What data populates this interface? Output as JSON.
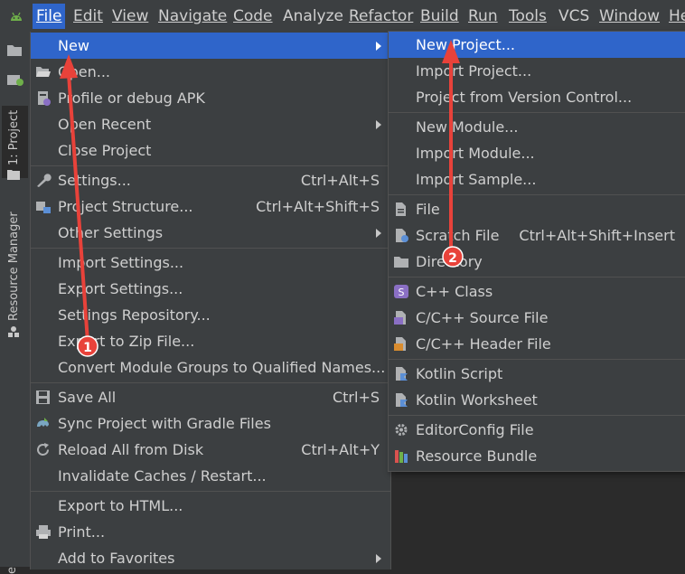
{
  "menubar": {
    "items": [
      "File",
      "Edit",
      "View",
      "Navigate",
      "Code",
      "Analyze",
      "Refactor",
      "Build",
      "Run",
      "Tools",
      "VCS",
      "Window",
      "He"
    ]
  },
  "tool_strip": {
    "project_tab": "1: Project",
    "resource_tab": "Resource Manager",
    "bottom_char": "e"
  },
  "file_menu": {
    "items": [
      {
        "label": "New",
        "shortcut": "",
        "submenu": true
      },
      {
        "label": "Open...",
        "shortcut": "",
        "submenu": false
      },
      {
        "label": "Profile or debug APK",
        "shortcut": "",
        "submenu": false
      },
      {
        "label": "Open Recent",
        "shortcut": "",
        "submenu": true
      },
      {
        "label": "Close Project",
        "shortcut": "",
        "submenu": false
      },
      {
        "label": "Settings...",
        "shortcut": "Ctrl+Alt+S",
        "submenu": false
      },
      {
        "label": "Project Structure...",
        "shortcut": "Ctrl+Alt+Shift+S",
        "submenu": false
      },
      {
        "label": "Other Settings",
        "shortcut": "",
        "submenu": true
      },
      {
        "label": "Import Settings...",
        "shortcut": "",
        "submenu": false
      },
      {
        "label": "Export Settings...",
        "shortcut": "",
        "submenu": false
      },
      {
        "label": "Settings Repository...",
        "shortcut": "",
        "submenu": false
      },
      {
        "label": "Export to Zip File...",
        "shortcut": "",
        "submenu": false
      },
      {
        "label": "Convert Module Groups to Qualified Names...",
        "shortcut": "",
        "submenu": false
      },
      {
        "label": "Save All",
        "shortcut": "Ctrl+S",
        "submenu": false
      },
      {
        "label": "Sync Project with Gradle Files",
        "shortcut": "",
        "submenu": false
      },
      {
        "label": "Reload All from Disk",
        "shortcut": "Ctrl+Alt+Y",
        "submenu": false
      },
      {
        "label": "Invalidate Caches / Restart...",
        "shortcut": "",
        "submenu": false
      },
      {
        "label": "Export to HTML...",
        "shortcut": "",
        "submenu": false
      },
      {
        "label": "Print...",
        "shortcut": "",
        "submenu": false
      },
      {
        "label": "Add to Favorites",
        "shortcut": "",
        "submenu": true
      }
    ]
  },
  "new_submenu": {
    "items": [
      {
        "label": "New Project...",
        "shortcut": ""
      },
      {
        "label": "Import Project...",
        "shortcut": ""
      },
      {
        "label": "Project from Version Control...",
        "shortcut": ""
      },
      {
        "label": "New Module...",
        "shortcut": ""
      },
      {
        "label": "Import Module...",
        "shortcut": ""
      },
      {
        "label": "Import Sample...",
        "shortcut": ""
      },
      {
        "label": "File",
        "shortcut": ""
      },
      {
        "label": "Scratch File",
        "shortcut": "Ctrl+Alt+Shift+Insert"
      },
      {
        "label": "Directory",
        "shortcut": ""
      },
      {
        "label": "C++ Class",
        "shortcut": ""
      },
      {
        "label": "C/C++ Source File",
        "shortcut": ""
      },
      {
        "label": "C/C++ Header File",
        "shortcut": ""
      },
      {
        "label": "Kotlin Script",
        "shortcut": ""
      },
      {
        "label": "Kotlin Worksheet",
        "shortcut": ""
      },
      {
        "label": "EditorConfig File",
        "shortcut": ""
      },
      {
        "label": "Resource Bundle",
        "shortcut": ""
      }
    ]
  },
  "annotations": {
    "step1": "1",
    "step2": "2"
  },
  "colors": {
    "selection": "#2f65ca",
    "annotation": "#e8423a",
    "menu_bg": "#3c3f41"
  }
}
